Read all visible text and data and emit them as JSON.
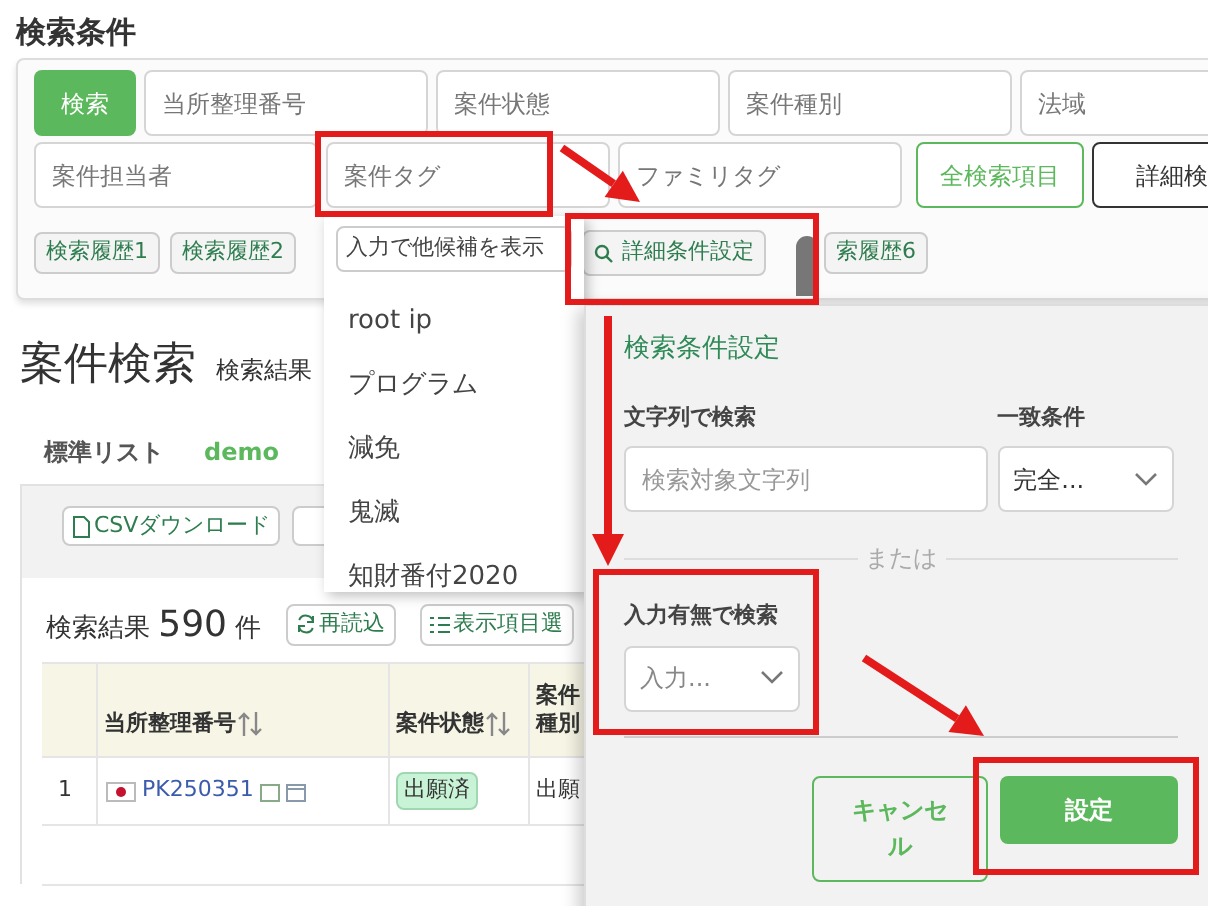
{
  "search_conditions": {
    "title": "検索条件",
    "search_button": "検索",
    "fields": [
      {
        "placeholder": "当所整理番号"
      },
      {
        "placeholder": "案件状態"
      },
      {
        "placeholder": "案件種別"
      },
      {
        "placeholder": "法域"
      },
      {
        "placeholder": "案件担当者"
      },
      {
        "placeholder": "案件タグ"
      },
      {
        "placeholder": "ファミリタグ"
      }
    ],
    "all_fields_button": "全検索項目",
    "detail_search_button": "詳細検",
    "history_buttons": [
      "検索履歴1",
      "検索履歴2"
    ],
    "detail_condition_button": "詳細条件設定",
    "history_button_partial": "索履歴6"
  },
  "tag_dropdown": {
    "placeholder": "入力で他候補を表示",
    "options": [
      "root ip",
      "プログラム",
      "減免",
      "鬼滅",
      "知財番付2020"
    ]
  },
  "case_search": {
    "title": "案件検索",
    "subtitle": "検索結果",
    "list_tabs": [
      {
        "label": "標準リスト",
        "selected": true
      },
      {
        "label": "demo",
        "selected": false
      }
    ],
    "csv_button": "CSVダウンロード",
    "result_label": "検索結果",
    "result_count": "590",
    "result_unit": "件",
    "reload_button": "再読込",
    "columns_button": "表示項目選",
    "table": {
      "columns": [
        {
          "label": "当所整理番号",
          "sortable": true
        },
        {
          "label": "案件状態",
          "sortable": true
        },
        {
          "label": "案件種別",
          "sortable": false
        }
      ],
      "rows": [
        {
          "index": "1",
          "number": "PK250351",
          "status": "出願済",
          "type": "出願"
        }
      ]
    }
  },
  "condition_popover": {
    "title": "検索条件設定",
    "text_label": "文字列で検索",
    "match_label": "一致条件",
    "text_placeholder": "検索対象文字列",
    "match_value": "完全...",
    "or_label": "または",
    "presence_label": "入力有無で検索",
    "presence_value": "入力...",
    "cancel_button": "キャンセル",
    "ok_button": "設定"
  }
}
